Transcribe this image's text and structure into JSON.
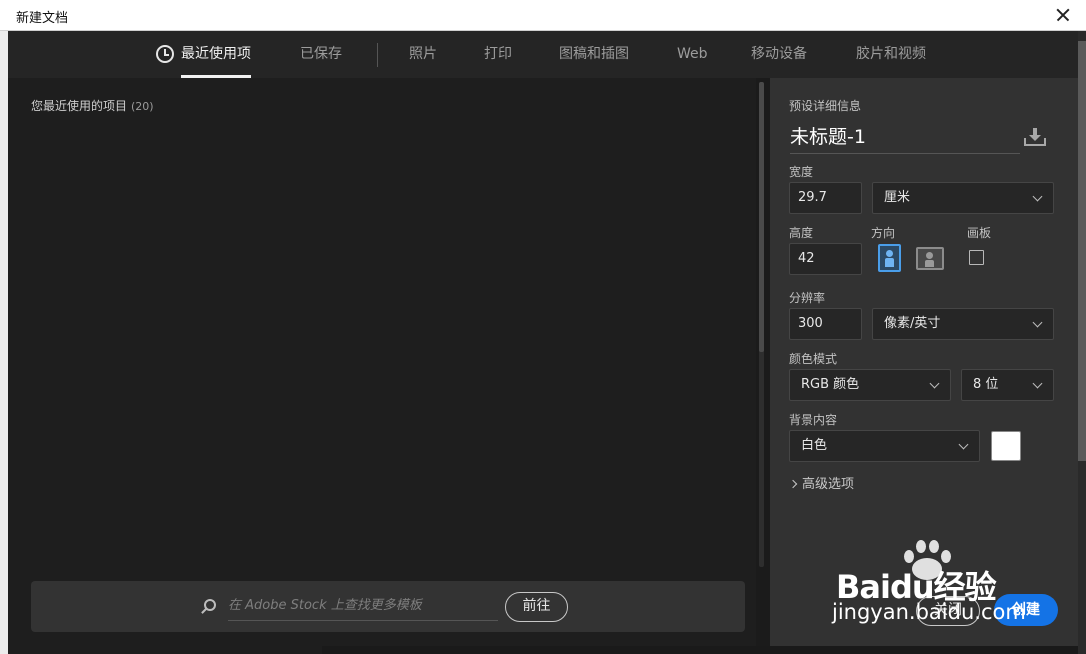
{
  "window": {
    "title": "新建文档"
  },
  "tabs": [
    {
      "label": "最近使用项",
      "active": true,
      "icon": "clock-icon"
    },
    {
      "label": "已保存"
    },
    {
      "label": "照片"
    },
    {
      "label": "打印"
    },
    {
      "label": "图稿和插图"
    },
    {
      "label": "Web"
    },
    {
      "label": "移动设备"
    },
    {
      "label": "胶片和视频"
    }
  ],
  "recent": {
    "title": "您最近使用的项目",
    "count": "(20)"
  },
  "stock": {
    "placeholder": "在 Adobe Stock 上查找更多模板",
    "go_label": "前往"
  },
  "preset": {
    "header": "预设详细信息",
    "name": "未标题-1",
    "width_label": "宽度",
    "width_value": "29.7",
    "width_unit": "厘米",
    "height_label": "高度",
    "height_value": "42",
    "orientation_label": "方向",
    "artboard_label": "画板",
    "resolution_label": "分辨率",
    "resolution_value": "300",
    "resolution_unit": "像素/英寸",
    "color_mode_label": "颜色模式",
    "color_mode_value": "RGB 颜色",
    "bit_depth_value": "8 位",
    "background_label": "背景内容",
    "background_value": "白色",
    "background_color": "#ffffff",
    "advanced_label": "高级选项"
  },
  "buttons": {
    "close_label": "关闭",
    "create_label": "创建"
  },
  "watermark": {
    "logo": "Baidu经验",
    "site": "jingyan.baidu.com"
  },
  "colors": {
    "accent": "#1473e6",
    "orientation_selected": "#4a9eea"
  }
}
